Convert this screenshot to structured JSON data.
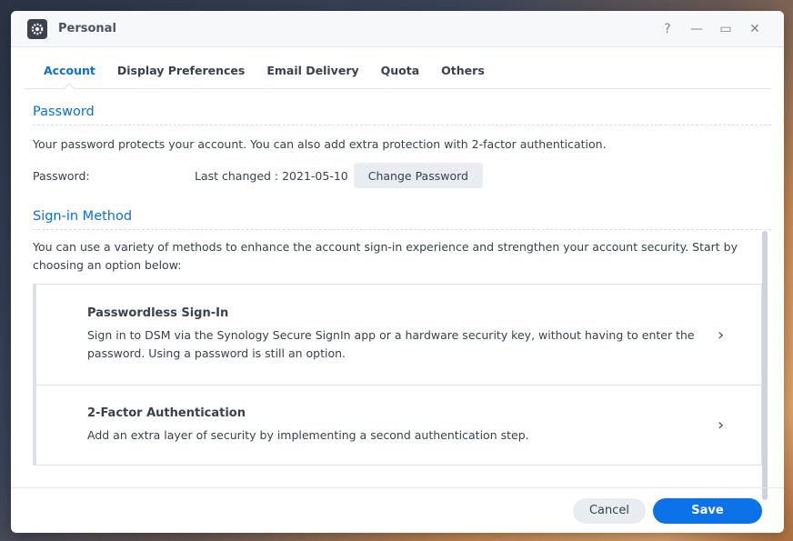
{
  "window": {
    "title": "Personal",
    "icons": {
      "app": "gear-icon",
      "help": "help-icon",
      "minimize": "minimize-icon",
      "maximize": "maximize-icon",
      "close": "close-icon"
    },
    "controls": {
      "help": "?",
      "minimize": "—",
      "maximize": "▭",
      "close": "✕"
    }
  },
  "tabs": [
    {
      "label": "Account",
      "active": true
    },
    {
      "label": "Display Preferences",
      "active": false
    },
    {
      "label": "Email Delivery",
      "active": false
    },
    {
      "label": "Quota",
      "active": false
    },
    {
      "label": "Others",
      "active": false
    }
  ],
  "password_section": {
    "title": "Password",
    "description": "Your password protects your account. You can also add extra protection with 2-factor authentication.",
    "label": "Password:",
    "last_changed": "Last changed : 2021-05-10",
    "change_button": "Change Password"
  },
  "signin_section": {
    "title": "Sign-in Method",
    "description": "You can use a variety of methods to enhance the account sign-in experience and strengthen your account security. Start by choosing an option below:",
    "options": [
      {
        "title": "Passwordless Sign-In",
        "description": "Sign in to DSM via the Synology Secure SignIn app or a hardware security key, without having to enter the password. Using a password is still an option."
      },
      {
        "title": "2-Factor Authentication",
        "description": "Add an extra layer of security by implementing a second authentication step."
      }
    ],
    "chevron_glyph": "›"
  },
  "footer": {
    "cancel": "Cancel",
    "save": "Save"
  },
  "colors": {
    "accent": "#0b6fd3",
    "save_button": "#0b72e7"
  }
}
